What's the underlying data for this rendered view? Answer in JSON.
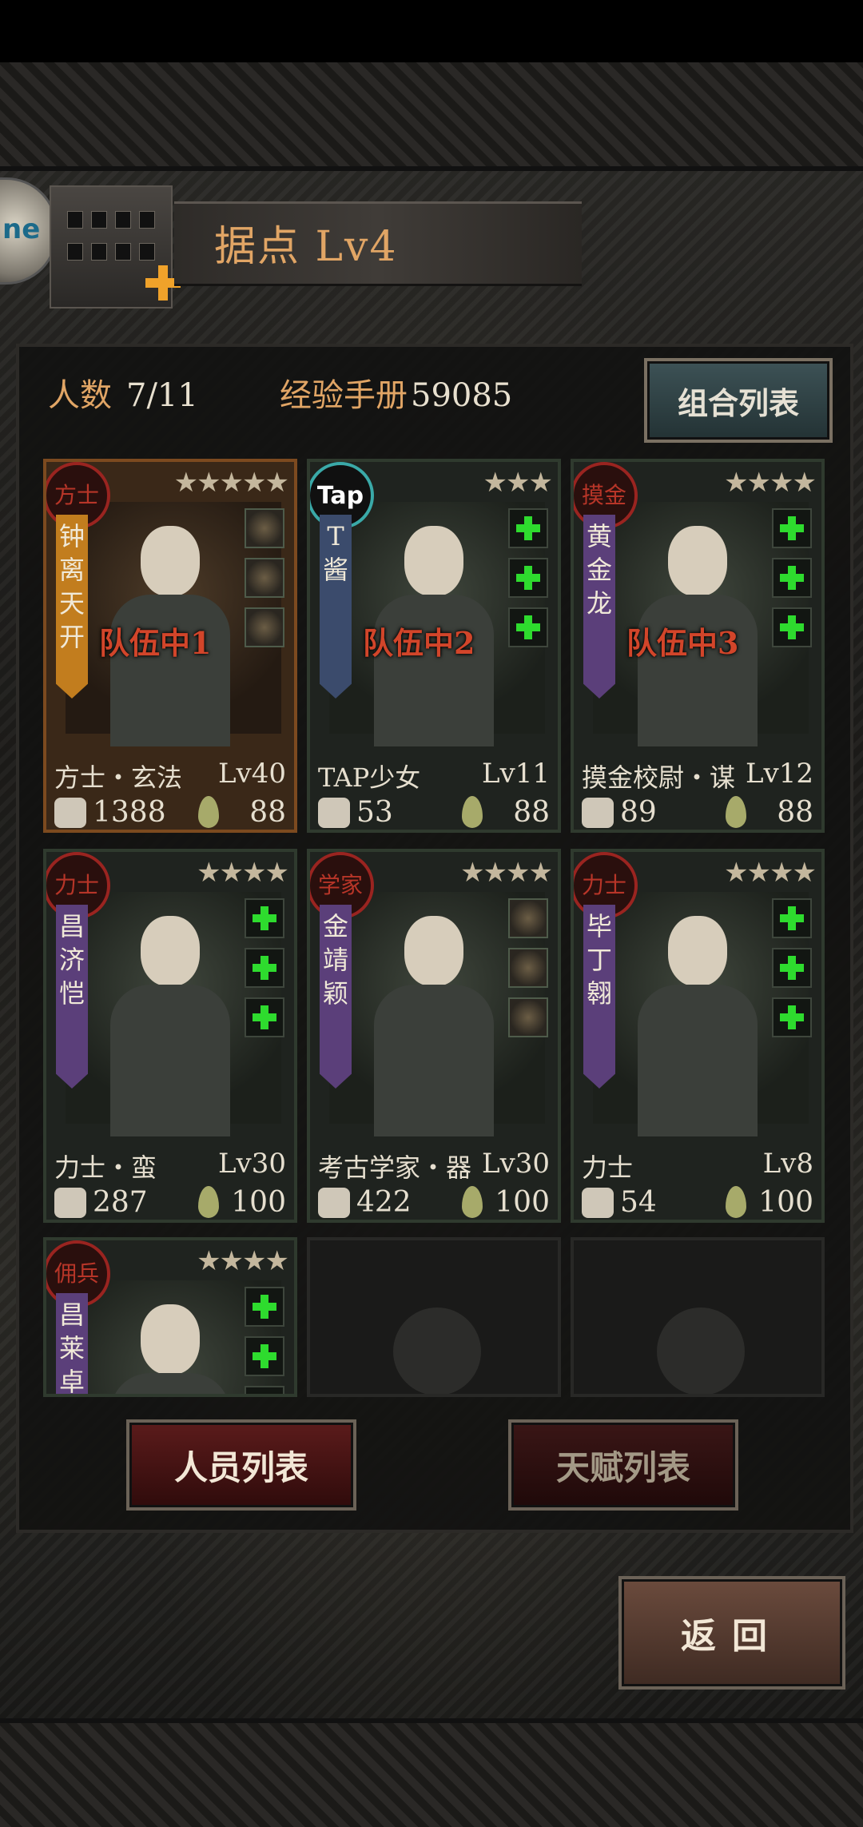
{
  "header": {
    "title": "据点  Lv4",
    "avatar_text": "ne"
  },
  "stats": {
    "population_label": "人数",
    "population_value": "7/11",
    "exp_label": "经验手册",
    "exp_value": "59085",
    "combo_button": "组合列表"
  },
  "cards": [
    {
      "badge": "方士",
      "stars": "★★★★★",
      "name": "钟离天开",
      "team": "队伍中1",
      "job": "方士・玄法",
      "level": "Lv40",
      "power": "1388",
      "energy": "88",
      "slots": [
        "item",
        "item",
        "item"
      ]
    },
    {
      "badge": "Tap",
      "stars": "★★★",
      "name": "T酱",
      "team": "队伍中2",
      "job": "TAP少女",
      "level": "Lv11",
      "power": "53",
      "energy": "88",
      "slots": [
        "add",
        "add",
        "add"
      ]
    },
    {
      "badge": "摸金",
      "stars": "★★★★",
      "name": "黄金龙",
      "team": "队伍中3",
      "job": "摸金校尉・谋",
      "level": "Lv12",
      "power": "89",
      "energy": "88",
      "slots": [
        "add",
        "add",
        "add"
      ]
    },
    {
      "badge": "力士",
      "stars": "★★★★",
      "name": "昌济恺",
      "team": "",
      "job": "力士・蛮",
      "level": "Lv30",
      "power": "287",
      "energy": "100",
      "slots": [
        "add",
        "add",
        "add"
      ]
    },
    {
      "badge": "学家",
      "stars": "★★★★",
      "name": "金靖颖",
      "team": "",
      "job": "考古学家・器",
      "level": "Lv30",
      "power": "422",
      "energy": "100",
      "slots": [
        "item",
        "item",
        "item"
      ]
    },
    {
      "badge": "力士",
      "stars": "★★★★",
      "name": "毕丁翱",
      "team": "",
      "job": "力士",
      "level": "Lv8",
      "power": "54",
      "energy": "100",
      "slots": [
        "add",
        "add",
        "add"
      ]
    },
    {
      "badge": "佣兵",
      "stars": "★★★★",
      "name": "昌莱卓",
      "slots": [
        "add",
        "add",
        "add"
      ]
    }
  ],
  "buttons": {
    "staff_list": "人员列表",
    "talent_list": "天赋列表",
    "back": "返回"
  }
}
